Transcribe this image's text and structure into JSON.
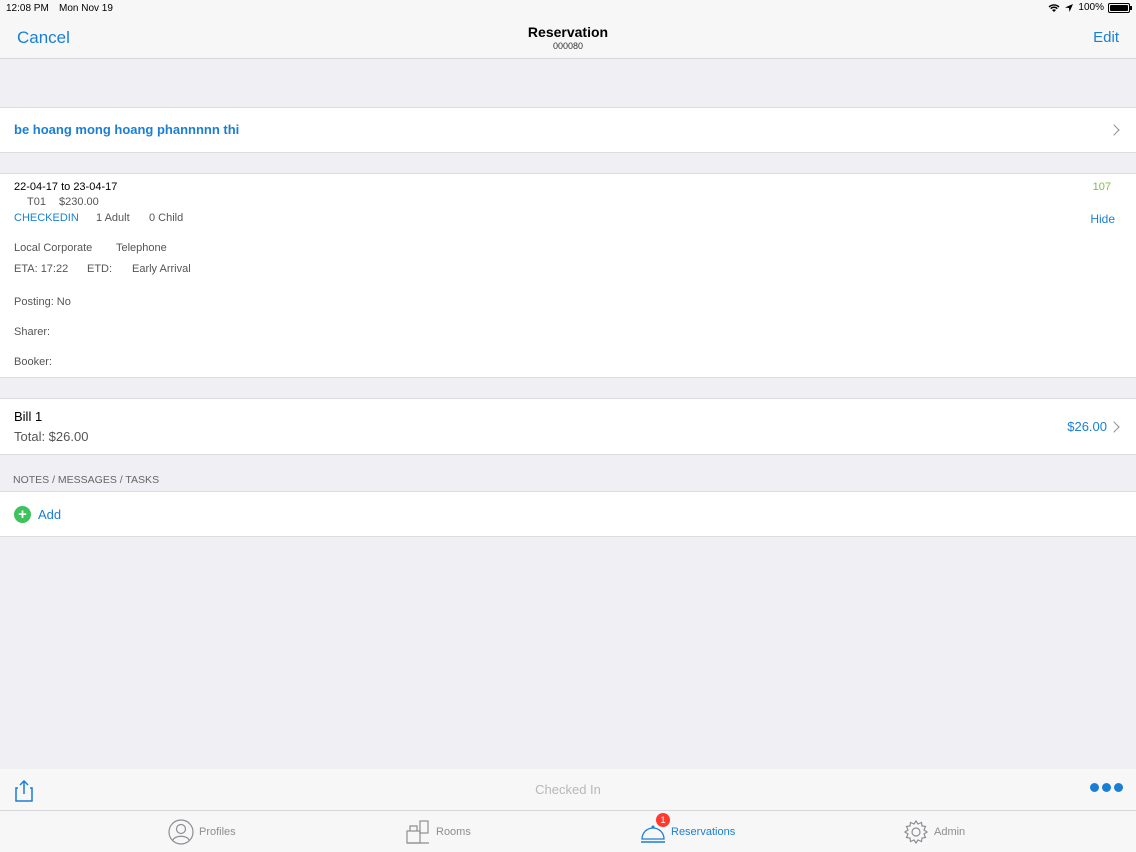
{
  "status_bar": {
    "time": "12:08 PM",
    "date": "Mon Nov 19",
    "battery": "100%",
    "battery_level": 1.0
  },
  "nav": {
    "cancel": "Cancel",
    "title": "Reservation",
    "subtitle": "000080",
    "edit": "Edit"
  },
  "guest": {
    "name": "be hoang mong hoang phannnnn thi"
  },
  "reservation": {
    "dates": "22-04-17 to 23-04-17",
    "room_number": "107",
    "room_type": "T01",
    "rate": "$230.00",
    "status": "CHECKEDIN",
    "adults": "1 Adult",
    "children": "0 Child",
    "hide_label": "Hide",
    "market": "Local Corporate",
    "source": "Telephone",
    "eta": "ETA: 17:22",
    "etd": "ETD:",
    "arrival_type": "Early Arrival",
    "posting": "Posting: No",
    "sharer": "Sharer:",
    "booker": "Booker:"
  },
  "bill": {
    "title": "Bill 1",
    "total": "Total: $26.00",
    "amount": "$26.00"
  },
  "notes": {
    "header": "NOTES / MESSAGES / TASKS",
    "add_label": "Add"
  },
  "toolbar": {
    "status": "Checked In"
  },
  "tabs": [
    {
      "label": "Profiles",
      "icon": "person-circle-icon"
    },
    {
      "label": "Rooms",
      "icon": "rooms-icon"
    },
    {
      "label": "Reservations",
      "icon": "bell-icon",
      "badge": "1"
    },
    {
      "label": "Admin",
      "icon": "gear-icon"
    }
  ],
  "colors": {
    "accent": "#1a7fd4",
    "room_number": "#7cc142",
    "add": "#3cc35b",
    "badge": "#ff3b30"
  }
}
